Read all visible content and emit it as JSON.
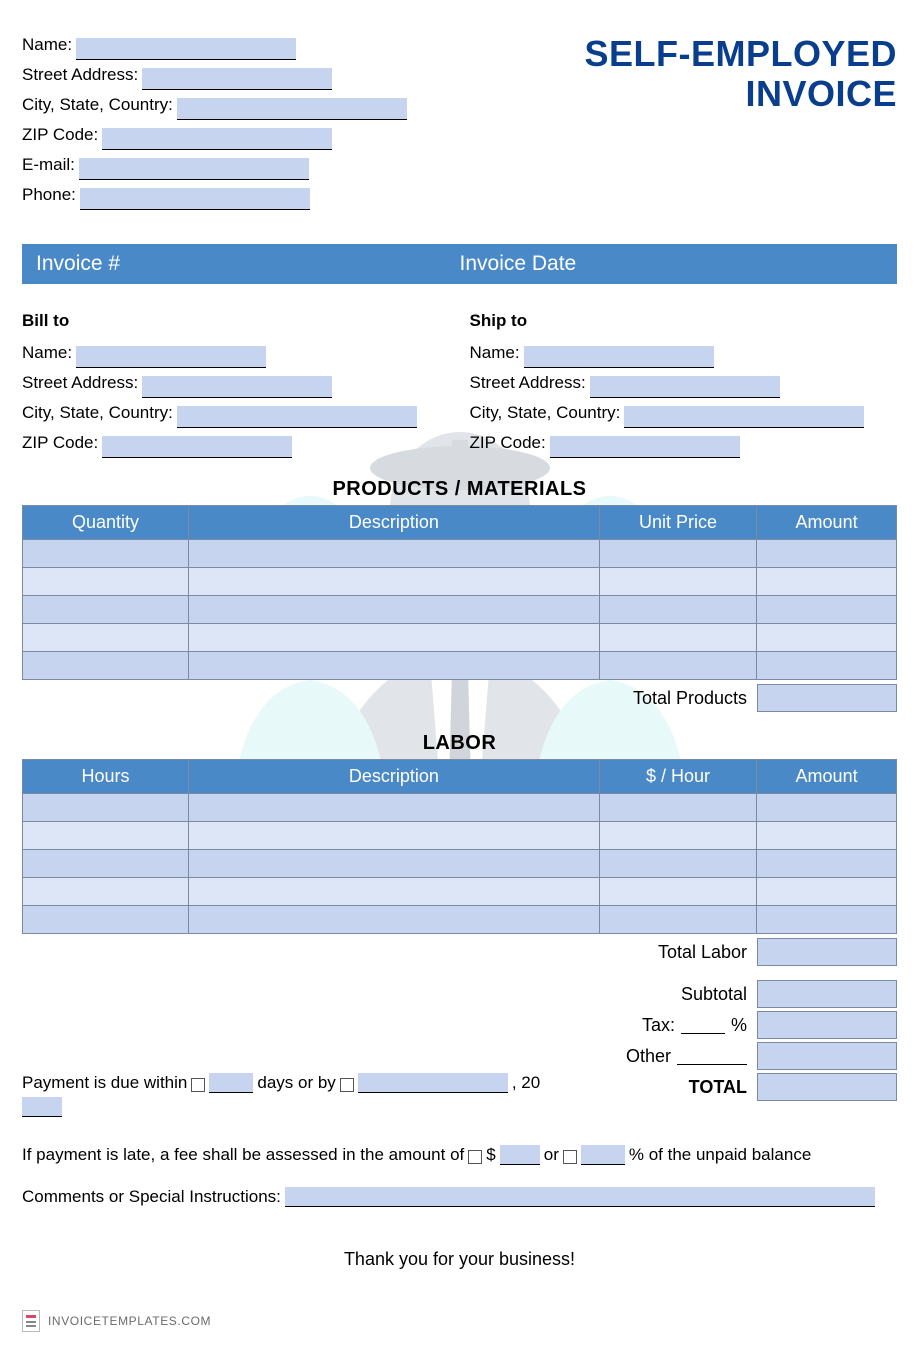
{
  "title_line1": "SELF-EMPLOYED",
  "title_line2": "INVOICE",
  "from": {
    "name_label": "Name:",
    "street_label": "Street Address:",
    "city_label": "City, State, Country:",
    "zip_label": "ZIP Code:",
    "email_label": "E-mail:",
    "phone_label": "Phone:"
  },
  "invoice_bar": {
    "number_label": "Invoice #",
    "date_label": "Invoice Date"
  },
  "bill_to": {
    "heading": "Bill to",
    "name_label": "Name:",
    "street_label": "Street Address:",
    "city_label": "City, State, Country:",
    "zip_label": "ZIP Code:"
  },
  "ship_to": {
    "heading": "Ship to",
    "name_label": "Name:",
    "street_label": "Street Address:",
    "city_label": "City, State, Country:",
    "zip_label": "ZIP Code:"
  },
  "products": {
    "section_title": "PRODUCTS / MATERIALS",
    "headers": {
      "qty": "Quantity",
      "desc": "Description",
      "price": "Unit Price",
      "amt": "Amount"
    },
    "total_label": "Total Products"
  },
  "labor": {
    "section_title": "LABOR",
    "headers": {
      "hours": "Hours",
      "desc": "Description",
      "rate": "$ / Hour",
      "amt": "Amount"
    },
    "total_label": "Total Labor"
  },
  "summary": {
    "subtotal": "Subtotal",
    "tax_prefix": "Tax:",
    "tax_suffix": "%",
    "other_label": "Other",
    "total_label": "TOTAL"
  },
  "payment_terms": {
    "prefix": "Payment is due within",
    "days_word": "days or by",
    "year_prefix": ", 20"
  },
  "late_fee": {
    "prefix": "If payment is late, a fee shall be assessed in the amount of",
    "dollar": "$",
    "or": "or",
    "suffix": "% of the unpaid balance"
  },
  "comments_label": "Comments or Special Instructions:",
  "thanks": "Thank you for your business!",
  "footer": "INVOICETEMPLATES.COM"
}
